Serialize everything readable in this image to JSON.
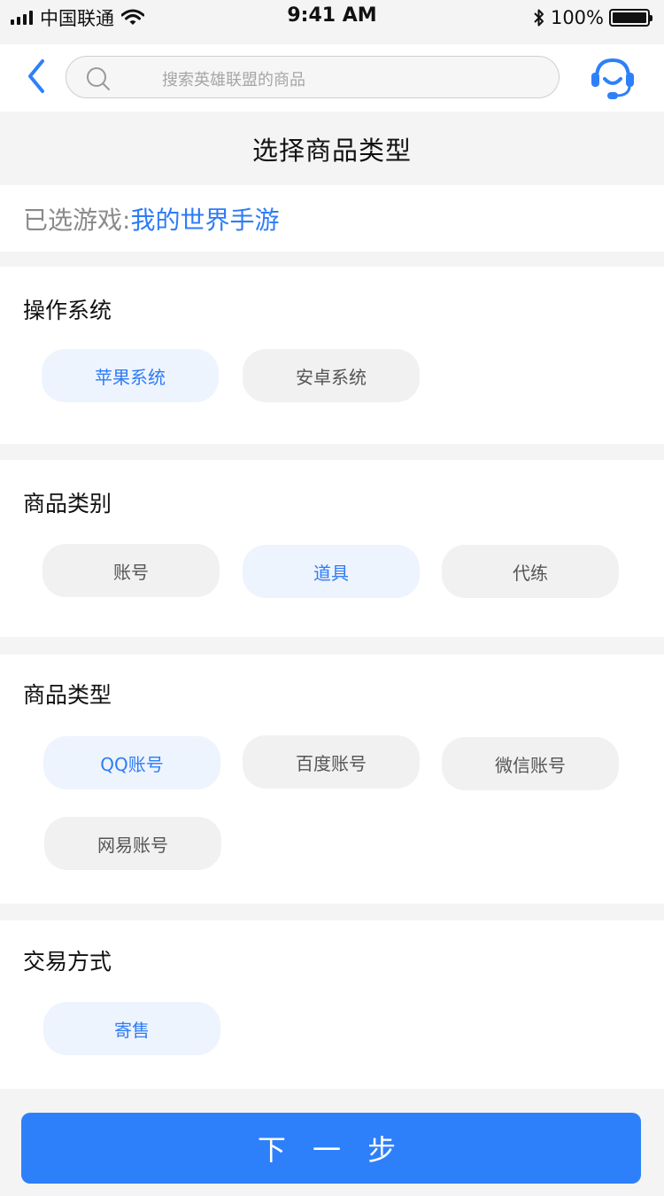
{
  "status_bar": {
    "carrier": "中国联通",
    "time": "9:41 AM",
    "battery_text": "100%"
  },
  "header": {
    "search_placeholder": "搜索英雄联盟的商品",
    "back_icon": "chevron-left-icon",
    "service_icon": "headset-icon"
  },
  "page": {
    "title": "选择商品类型"
  },
  "selected_game": {
    "label": "已选游戏:",
    "value": "我的世界手游"
  },
  "sections": {
    "os": {
      "title": "操作系统",
      "options": [
        "苹果系统",
        "安卓系统"
      ],
      "selected": "苹果系统"
    },
    "category": {
      "title": "商品类别",
      "options": [
        "账号",
        "道具",
        "代练"
      ],
      "selected": "道具"
    },
    "type": {
      "title": "商品类型",
      "options": [
        "QQ账号",
        "百度账号",
        "微信账号",
        "网易账号"
      ],
      "selected": "QQ账号"
    },
    "trade": {
      "title": "交易方式",
      "options": [
        "寄售"
      ],
      "selected": "寄售"
    }
  },
  "footer": {
    "next_label": "下 一 步"
  },
  "colors": {
    "accent": "#2e80fa",
    "chip_selected_bg": "#eef4fd",
    "chip_selected_text": "#2e7cf6",
    "chip_bg": "#f1f1f1"
  }
}
